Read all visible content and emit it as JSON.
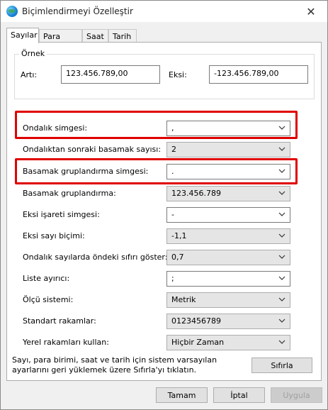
{
  "window": {
    "title": "Biçimlendirmeyi Özelleştir",
    "close_glyph": "✕"
  },
  "tabs": [
    {
      "label": "Sayılar",
      "active": true
    },
    {
      "label": "Para Birimi",
      "active": false
    },
    {
      "label": "Saat",
      "active": false
    },
    {
      "label": "Tarih",
      "active": false
    }
  ],
  "example": {
    "legend": "Örnek",
    "positive_label": "Artı:",
    "positive_value": "123.456.789,00",
    "negative_label": "Eksi:",
    "negative_value": "-123.456.789,00"
  },
  "settings": [
    {
      "label": "Ondalık simgesi:",
      "value": ",",
      "editable": true
    },
    {
      "label": "Ondalıktan sonraki basamak sayısı:",
      "value": "2",
      "editable": false
    },
    {
      "label": "Basamak gruplandırma simgesi:",
      "value": ".",
      "editable": true
    },
    {
      "label": "Basamak gruplandırma:",
      "value": "123.456.789",
      "editable": false
    },
    {
      "label": "Eksi işareti simgesi:",
      "value": "-",
      "editable": true
    },
    {
      "label": "Eksi sayı biçimi:",
      "value": "-1,1",
      "editable": false
    },
    {
      "label": "Ondalık sayılarda öndeki sıfırı göster:",
      "value": "0,7",
      "editable": false
    },
    {
      "label": "Liste ayırıcı:",
      "value": ";",
      "editable": true
    },
    {
      "label": "Ölçü sistemi:",
      "value": "Metrik",
      "editable": false
    },
    {
      "label": "Standart rakamlar:",
      "value": "0123456789",
      "editable": false
    },
    {
      "label": "Yerel rakamları kullan:",
      "value": "Hiçbir Zaman",
      "editable": false
    }
  ],
  "reset": {
    "note": "Sayı, para birimi, saat ve tarih için sistem varsayılan ayarlarını geri yüklemek üzere Sıfırla'yı tıklatın.",
    "button": "Sıfırla"
  },
  "footer": {
    "ok": "Tamam",
    "cancel": "İptal",
    "apply": "Uygula"
  },
  "colors": {
    "highlight": "#e00000",
    "window_bg": "#f0f0f0"
  }
}
